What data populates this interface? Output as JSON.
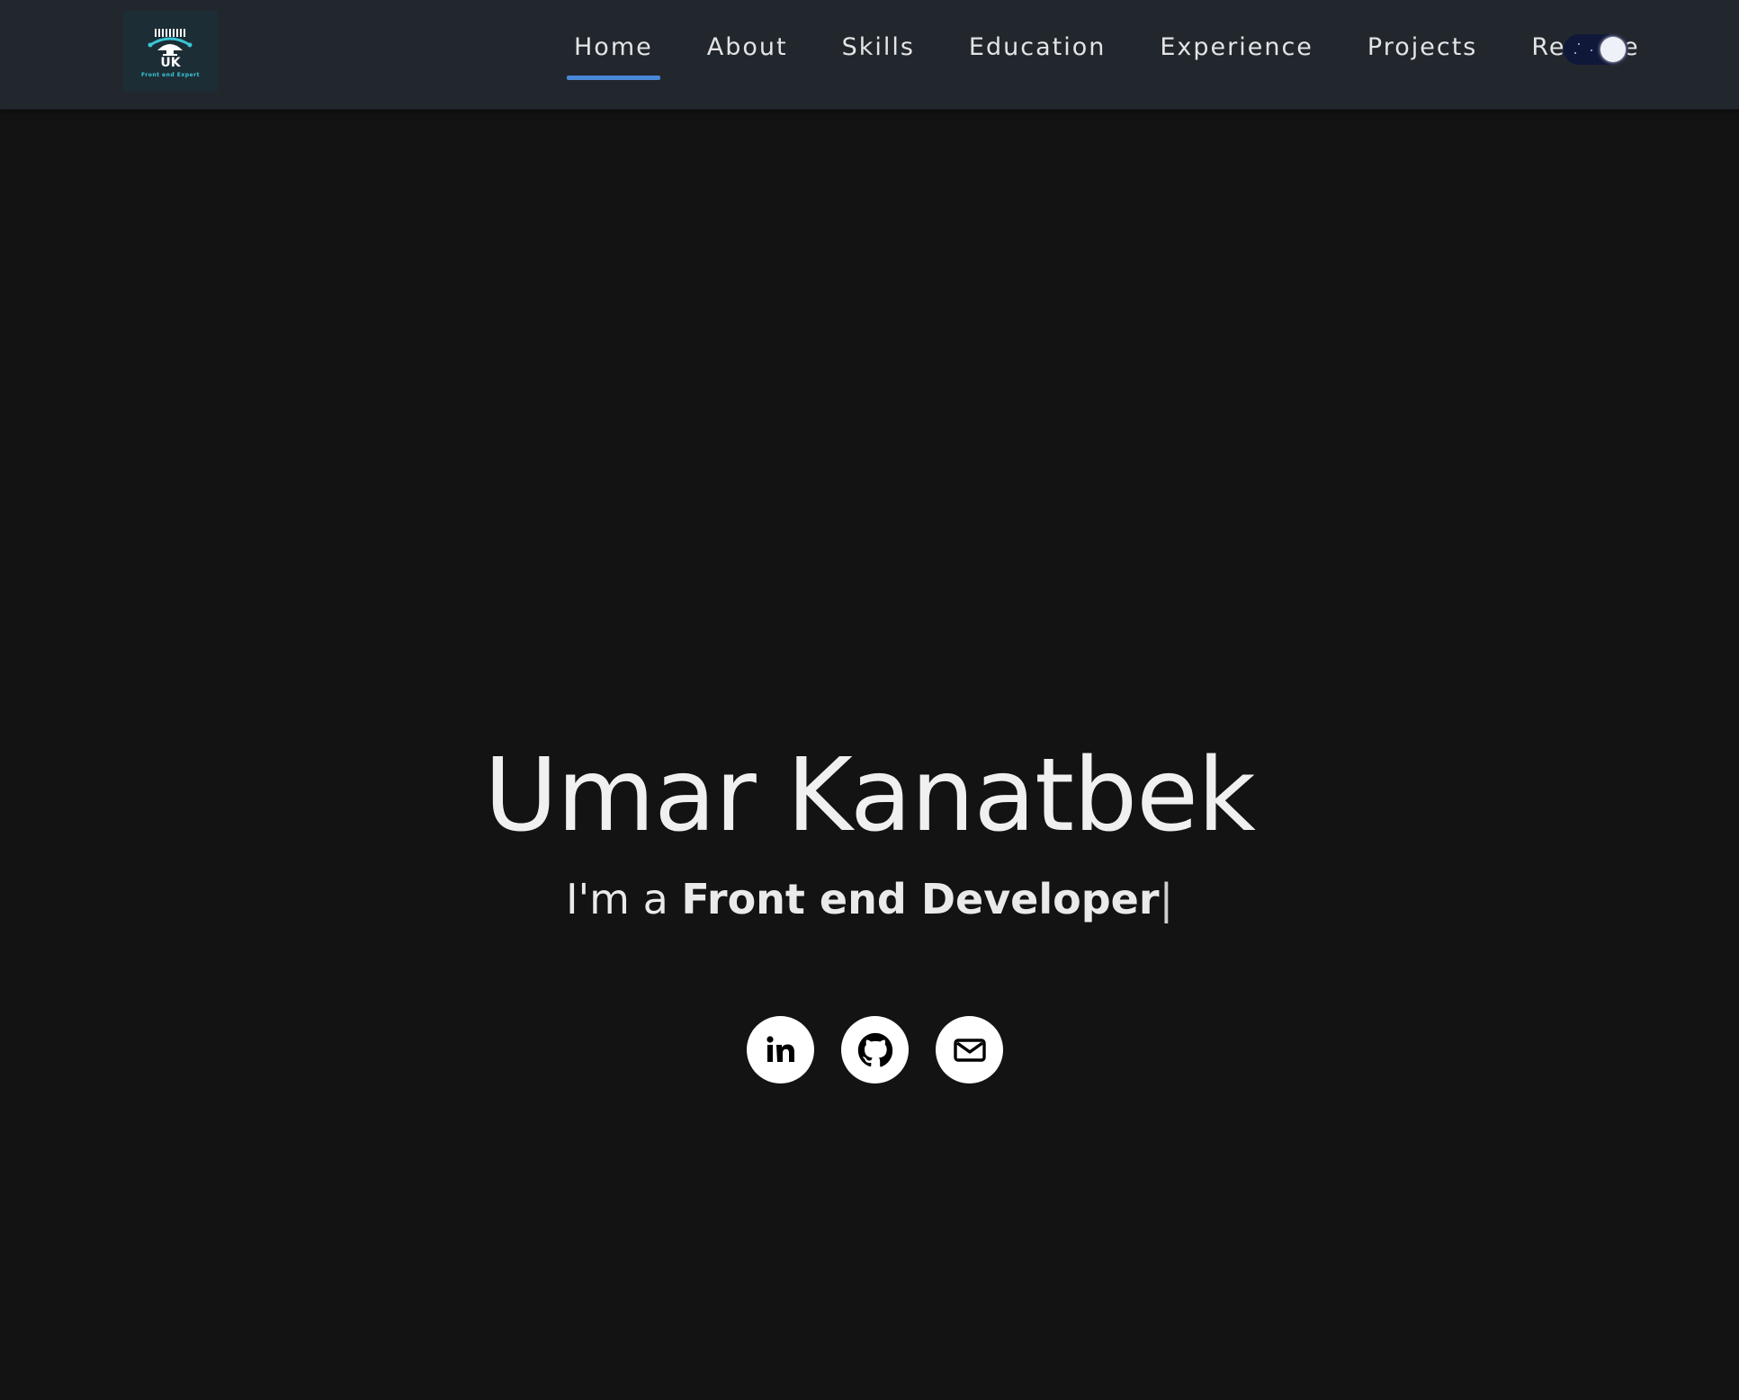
{
  "logo": {
    "monogram": "UK",
    "tagline": "Front end Expert",
    "colors": {
      "background": "#1d2d35",
      "accent": "#39c6d6"
    }
  },
  "nav": {
    "items": [
      {
        "label": "Home",
        "active": true
      },
      {
        "label": "About",
        "active": false
      },
      {
        "label": "Skills",
        "active": false
      },
      {
        "label": "Education",
        "active": false
      },
      {
        "label": "Experience",
        "active": false
      },
      {
        "label": "Projects",
        "active": false
      },
      {
        "label": "Resume",
        "active": false
      }
    ],
    "active_underline_color": "#4a88d8"
  },
  "theme_toggle": {
    "mode": "dark",
    "icon": "moon-night-toggle"
  },
  "hero": {
    "name": "Umar Kanatbek",
    "tagline_prefix": "I'm a ",
    "tagline_role": "Front end Developer",
    "tagline_cursor": "|"
  },
  "socials": [
    {
      "icon": "linkedin-icon"
    },
    {
      "icon": "github-icon"
    },
    {
      "icon": "mail-icon"
    }
  ],
  "colors": {
    "page_background": "#131313",
    "navbar_background": "#22272e",
    "text": "#f0f0f0"
  }
}
